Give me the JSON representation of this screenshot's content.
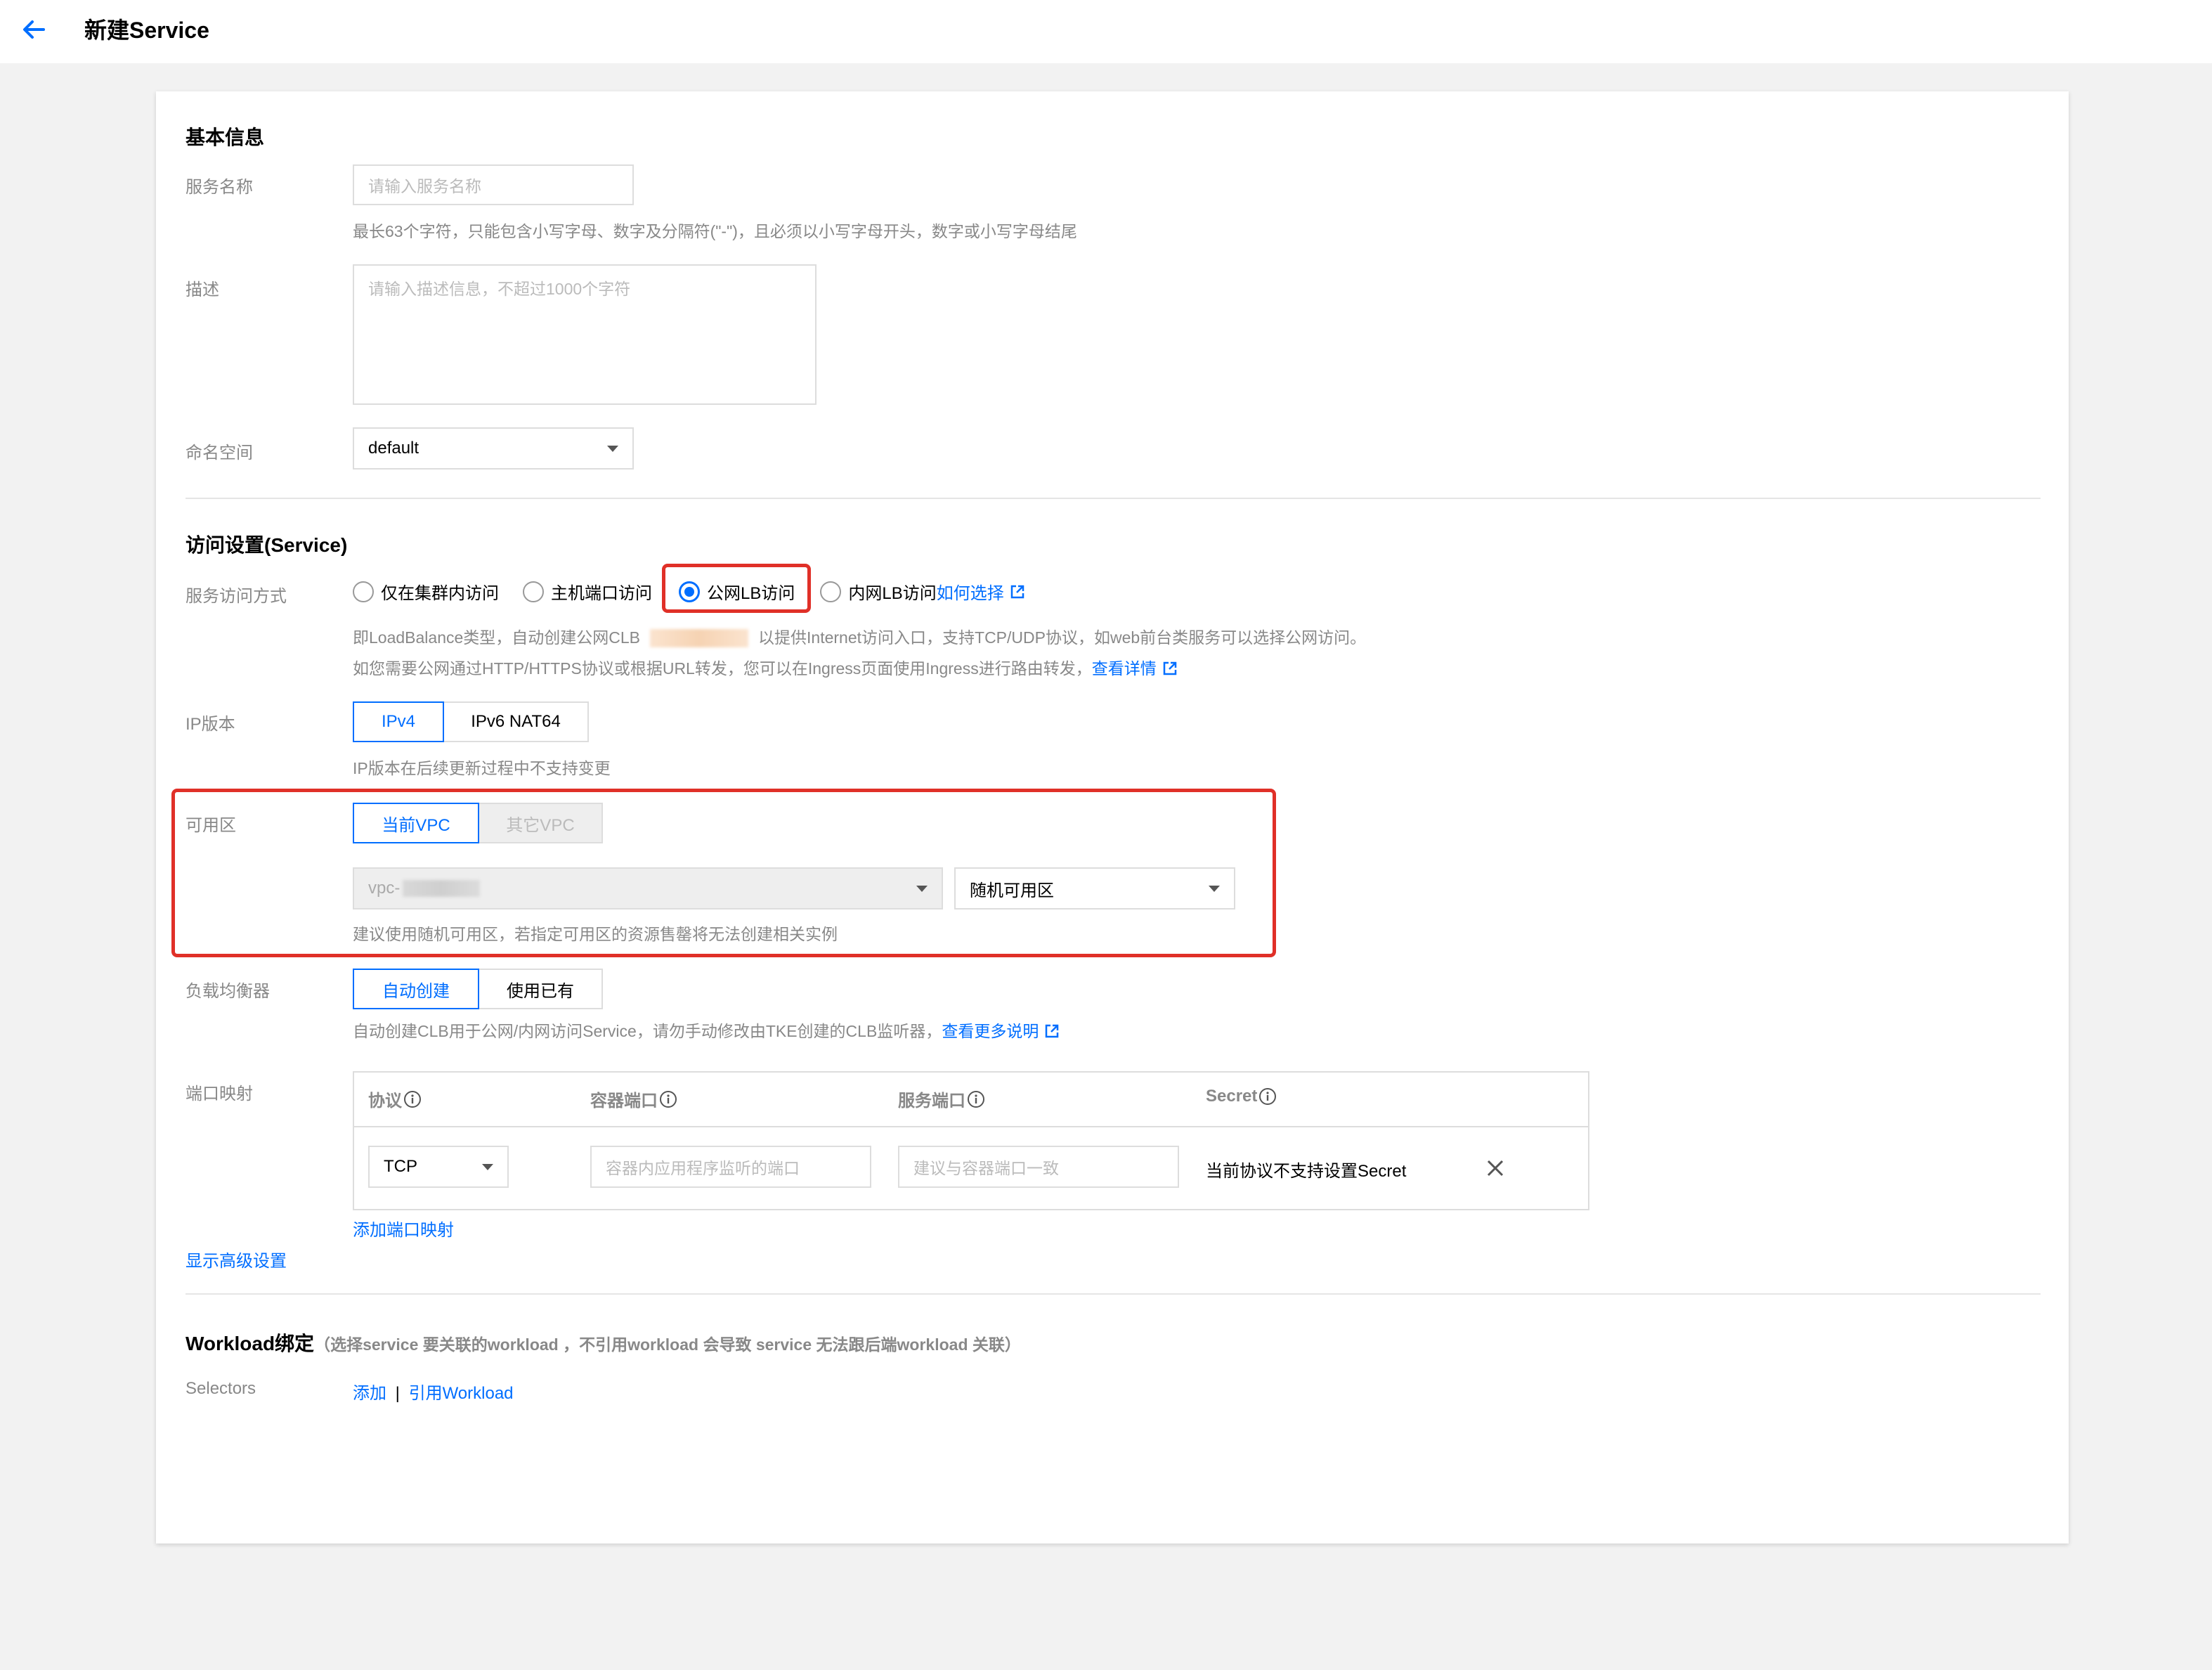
{
  "header": {
    "title": "新建Service"
  },
  "basic": {
    "section_title": "基本信息",
    "name_label": "服务名称",
    "name_placeholder": "请输入服务名称",
    "name_hint": "最长63个字符，只能包含小写字母、数字及分隔符(\"-\")，且必须以小写字母开头，数字或小写字母结尾",
    "desc_label": "描述",
    "desc_placeholder": "请输入描述信息，不超过1000个字符",
    "namespace_label": "命名空间",
    "namespace_value": "default"
  },
  "access": {
    "section_title": "访问设置(Service)",
    "mode_label": "服务访问方式",
    "modes": [
      {
        "label": "仅在集群内访问",
        "checked": false
      },
      {
        "label": "主机端口访问",
        "checked": false
      },
      {
        "label": "公网LB访问",
        "checked": true
      },
      {
        "label": "内网LB访问",
        "checked": false
      }
    ],
    "how_to_choose": "如何选择",
    "desc_line1_a": "即LoadBalance类型，自动创建公网CLB",
    "desc_line1_b": "以提供Internet访问入口，支持TCP/UDP协议，如web前台类服务可以选择公网访问。",
    "desc_line2": "如您需要公网通过HTTP/HTTPS协议或根据URL转发，您可以在Ingress页面使用Ingress进行路由转发，",
    "view_details": "查看详情",
    "ip_label": "IP版本",
    "ip_options": [
      "IPv4",
      "IPv6 NAT64"
    ],
    "ip_hint": "IP版本在后续更新过程中不支持变更",
    "az_label": "可用区",
    "vpc_options": [
      "当前VPC",
      "其它VPC"
    ],
    "vpc_value": "vpc-",
    "zone_value": "随机可用区",
    "az_hint": "建议使用随机可用区，若指定可用区的资源售罄将无法创建相关实例",
    "lb_label": "负载均衡器",
    "lb_options": [
      "自动创建",
      "使用已有"
    ],
    "lb_hint": "自动创建CLB用于公网/内网访问Service，请勿手动修改由TKE创建的CLB监听器，",
    "lb_more": "查看更多说明",
    "port_label": "端口映射",
    "port_headers": [
      "协议",
      "容器端口",
      "服务端口",
      "Secret"
    ],
    "port_row": {
      "protocol": "TCP",
      "container_placeholder": "容器内应用程序监听的端口",
      "service_placeholder": "建议与容器端口一致",
      "secret_text": "当前协议不支持设置Secret"
    },
    "add_port": "添加端口映射",
    "show_advanced": "显示高级设置"
  },
  "workload": {
    "section_title": "Workload绑定",
    "section_note": "（选择service 要关联的workload ，不引用workload 会导致 service 无法跟后端workload 关联）",
    "selectors_label": "Selectors",
    "add_link": "添加",
    "separator": "|",
    "ref_link": "引用Workload"
  },
  "colors": {
    "accent": "#006eff",
    "highlight": "#e03028"
  },
  "icons": [
    "arrow-left-icon",
    "caret-down-icon",
    "external-link-icon",
    "info-icon",
    "close-icon"
  ]
}
